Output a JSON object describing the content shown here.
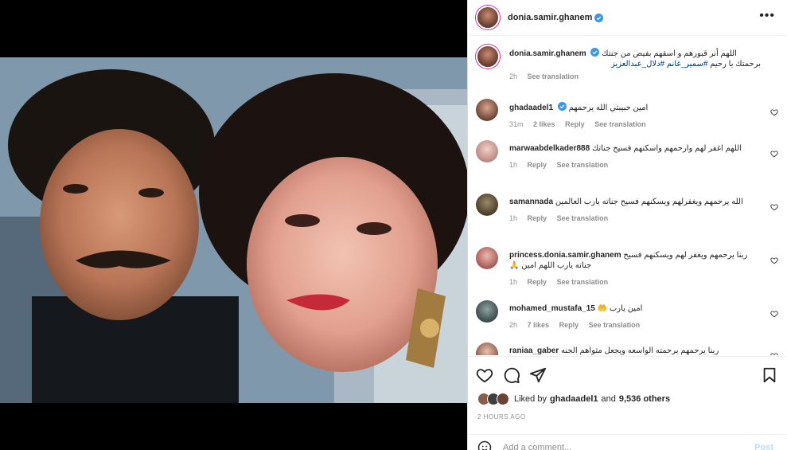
{
  "post": {
    "owner": "donia.samir.ghanem",
    "media_description": "photo of a man and woman"
  },
  "caption": {
    "username": "donia.samir.ghanem",
    "text_line1": "اللهم أنر قبورهم و اسقهم بفيض من جنتك",
    "text_line2_plain": "برحمتك يا رحيم",
    "hashtag1": "#سمير_غانم",
    "hashtag2": "#دلال_عبدالعزيز",
    "time": "2h",
    "see_translation": "See translation"
  },
  "comments": [
    {
      "username": "ghadaadel1",
      "verified": true,
      "text": "امين حبيبتي الله يرحمهم",
      "time": "31m",
      "likes": "2 likes",
      "reply": "Reply",
      "see_translation": "See translation"
    },
    {
      "username": "marwaabdelkader888",
      "verified": false,
      "text": "اللهم اغفر لهم وارحمهم واسكنهم فسيح جناتك",
      "time": "1h",
      "likes": "",
      "reply": "Reply",
      "see_translation": "See translation"
    },
    {
      "username": "samannada",
      "verified": false,
      "text": "الله يرحمهم ويغفرلهم ويسكنهم فسيح جناته يارب العالمين",
      "time": "1h",
      "likes": "",
      "reply": "Reply",
      "see_translation": "See translation"
    },
    {
      "username": "princess.donia.samir.ghanem",
      "verified": false,
      "text": "ربنا يرحمهم ويغفر لهم ويسكنهم فسيح جناته يارب اللهم امين 🙏",
      "time": "1h",
      "likes": "",
      "reply": "Reply",
      "see_translation": "See translation"
    },
    {
      "username": "mohamed_mustafa_15",
      "verified": false,
      "text": "امين يارب 🤲",
      "time": "2h",
      "likes": "7 likes",
      "reply": "Reply",
      "see_translation": "See translation"
    },
    {
      "username": "raniaa_gaber",
      "verified": false,
      "text": "ربنا يرحمهم برحمته الواسعه ويجعل مثواهم الجنه",
      "time": "",
      "likes": "",
      "reply": "",
      "see_translation": ""
    }
  ],
  "likes": {
    "prefix": "Liked by",
    "user": "ghadaadel1",
    "and": "and",
    "others": "9,536 others"
  },
  "time_ago": "2 HOURS AGO",
  "add_comment": {
    "placeholder": "Add a comment...",
    "post_label": "Post"
  },
  "icons": {
    "more": "more-horizontal-icon",
    "like": "heart-icon",
    "comment": "comment-icon",
    "share": "paper-plane-icon",
    "save": "bookmark-icon",
    "verified": "verified-badge-icon",
    "emoji": "emoji-icon"
  },
  "colors": {
    "verified": "#3897f0",
    "hashtag": "#00376b",
    "secondary": "#8e8e8e",
    "post_disabled": "#b2dffc"
  }
}
